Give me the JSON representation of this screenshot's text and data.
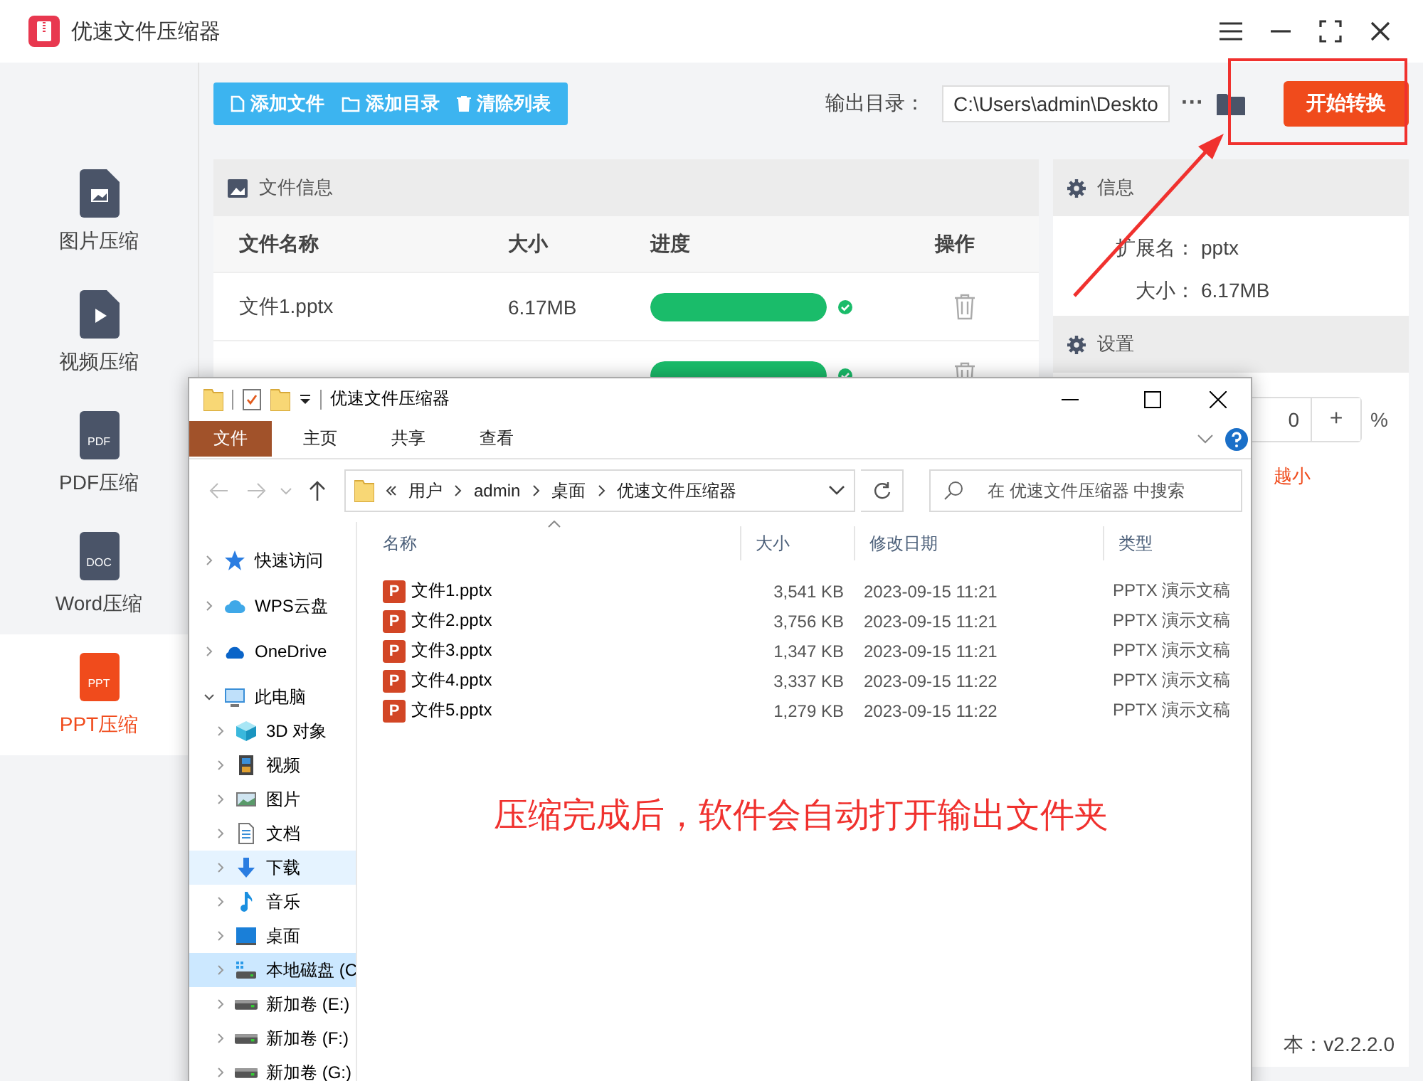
{
  "app": {
    "title": "优速文件压缩器"
  },
  "sidebar": {
    "items": [
      {
        "label": "图片压缩",
        "kind": "image",
        "selected": false
      },
      {
        "label": "视频压缩",
        "kind": "video",
        "selected": false
      },
      {
        "label": "PDF压缩",
        "kind": "doc",
        "badge": "PDF",
        "selected": false
      },
      {
        "label": "Word压缩",
        "kind": "doc",
        "badge": "DOC",
        "selected": false
      },
      {
        "label": "PPT压缩",
        "kind": "doc",
        "badge": "PPT",
        "selected": true
      }
    ]
  },
  "toolbar": {
    "buttons": [
      {
        "label": "添加文件",
        "kind": "file"
      },
      {
        "label": "添加目录",
        "kind": "folder"
      },
      {
        "label": "清除列表",
        "kind": "trash"
      }
    ],
    "output_label": "输出目录：",
    "output_path": "C:\\Users\\admin\\Deskto",
    "more": "···",
    "start_button": "开始转换"
  },
  "file_panel": {
    "title": "文件信息",
    "columns": [
      "文件名称",
      "大小",
      "进度",
      "操作"
    ],
    "rows": [
      {
        "name": "文件1.pptx",
        "size": "6.17MB",
        "level": 1,
        "done": true
      },
      {
        "level": 1,
        "done": true
      }
    ]
  },
  "info_panel": {
    "title": "信息",
    "fields": [
      {
        "label": "扩展名：",
        "value": "pptx"
      },
      {
        "label": "大小：",
        "value": "6.17MB"
      }
    ]
  },
  "settings_panel": {
    "title": "设置",
    "value": "0",
    "plus": "+",
    "unit": "%",
    "hint": "越小"
  },
  "version": "本：v2.2.2.0",
  "explorer": {
    "title": "优速文件压缩器",
    "ribbon_tabs": [
      {
        "label": "文件",
        "selected": true
      },
      {
        "label": "主页",
        "selected": false
      },
      {
        "label": "共享",
        "selected": false
      },
      {
        "label": "查看",
        "selected": false
      }
    ],
    "breadcrumb": [
      "用户",
      "admin",
      "桌面",
      "优速文件压缩器"
    ],
    "search": {
      "placeholder": "在 优速文件压缩器 中搜索"
    },
    "nav": [
      {
        "label": "快速访问",
        "kind": "star",
        "expanded": false,
        "selected": false,
        "hovered": false
      },
      {
        "label": "WPS云盘",
        "kind": "cloud",
        "expanded": false,
        "selected": false,
        "hovered": false
      },
      {
        "label": "OneDrive",
        "kind": "onedrive",
        "expanded": false,
        "selected": false,
        "hovered": false
      },
      {
        "label": "此电脑",
        "kind": "pc",
        "expanded": true,
        "selected": false,
        "hovered": false,
        "children": [
          {
            "label": "3D 对象",
            "kind": "cube",
            "expanded": false,
            "selected": false,
            "hovered": false
          },
          {
            "label": "视频",
            "kind": "film",
            "expanded": false,
            "selected": false,
            "hovered": false
          },
          {
            "label": "图片",
            "kind": "picture",
            "expanded": false,
            "selected": false,
            "hovered": false
          },
          {
            "label": "文档",
            "kind": "document",
            "expanded": false,
            "selected": false,
            "hovered": false
          },
          {
            "label": "下载",
            "kind": "download",
            "expanded": false,
            "selected": false,
            "hovered": true
          },
          {
            "label": "音乐",
            "kind": "music",
            "expanded": false,
            "selected": false,
            "hovered": false
          },
          {
            "label": "桌面",
            "kind": "desktop",
            "expanded": false,
            "selected": false,
            "hovered": false
          },
          {
            "label": "本地磁盘 (C",
            "kind": "systemdrive",
            "expanded": false,
            "selected": true,
            "hovered": false
          },
          {
            "label": "新加卷 (E:)",
            "kind": "drive",
            "expanded": false,
            "selected": false,
            "hovered": false
          },
          {
            "label": "新加卷 (F:)",
            "kind": "drive",
            "expanded": false,
            "selected": false,
            "hovered": false
          },
          {
            "label": "新加卷 (G:)",
            "kind": "drive",
            "expanded": false,
            "selected": false,
            "hovered": false
          }
        ]
      }
    ],
    "columns": [
      "名称",
      "大小",
      "修改日期",
      "类型"
    ],
    "files": [
      {
        "name": "文件1.pptx",
        "size": "3,541 KB",
        "date": "2023-09-15 11:21",
        "type": "PPTX 演示文稿",
        "icon": "P"
      },
      {
        "name": "文件2.pptx",
        "size": "3,756 KB",
        "date": "2023-09-15 11:21",
        "type": "PPTX 演示文稿",
        "icon": "P"
      },
      {
        "name": "文件3.pptx",
        "size": "1,347 KB",
        "date": "2023-09-15 11:21",
        "type": "PPTX 演示文稿",
        "icon": "P"
      },
      {
        "name": "文件4.pptx",
        "size": "3,337 KB",
        "date": "2023-09-15 11:22",
        "type": "PPTX 演示文稿",
        "icon": "P"
      },
      {
        "name": "文件5.pptx",
        "size": "1,279 KB",
        "date": "2023-09-15 11:22",
        "type": "PPTX 演示文稿",
        "icon": "P"
      }
    ]
  },
  "annotation": {
    "text": "压缩完成后，软件会自动打开输出文件夹"
  }
}
